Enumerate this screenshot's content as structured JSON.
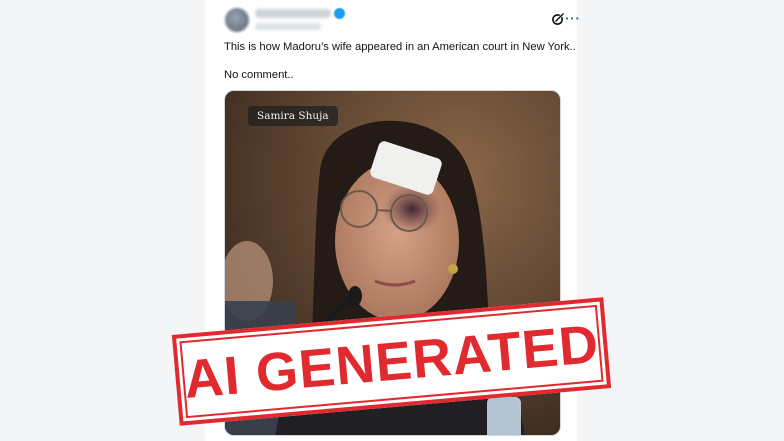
{
  "post": {
    "author_name": "",
    "author_handle": "",
    "lines": [
      "This is how Madoru’s wife appeared in an American court in New York..",
      "No comment.."
    ],
    "image_caption": "Samira Shuja"
  },
  "overlay": {
    "stamp_text": "AI GENERATED",
    "stamp_color": "#e02a2f"
  },
  "icons": {
    "author_badge": "verified-badge-icon",
    "grok": "grok-icon",
    "more": "more-options-icon"
  },
  "colors": {
    "page_background": "#f4f5f6",
    "card_background": "#ffffff",
    "text": "#0f1419"
  }
}
